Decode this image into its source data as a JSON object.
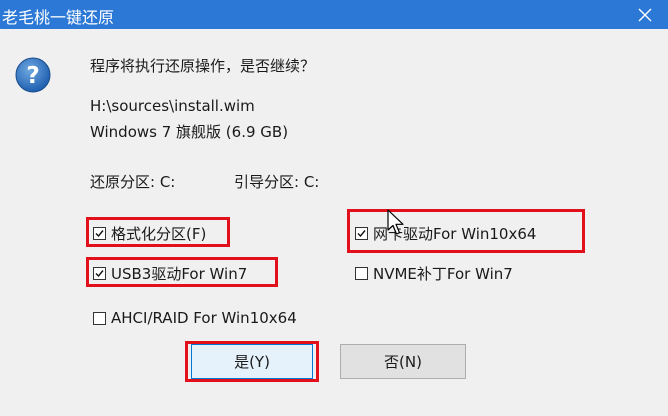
{
  "window": {
    "title": "老毛桃一键还原"
  },
  "dialog": {
    "question": "程序将执行还原操作，是否继续？",
    "image_path": "H:\\sources\\install.wim",
    "image_edition": "Windows 7 旗舰版 (6.9 GB)",
    "restore_partition": "还原分区: C:",
    "boot_partition": "引导分区: C:"
  },
  "options": {
    "format_partition": {
      "label": "格式化分区(F)",
      "checked": true
    },
    "nic_driver": {
      "label": "网卡驱动For Win10x64",
      "checked": true
    },
    "usb3_driver": {
      "label": "USB3驱动For Win7",
      "checked": true
    },
    "nvme_patch": {
      "label": "NVME补丁For Win7",
      "checked": false
    },
    "ahci_raid": {
      "label": "AHCI/RAID For Win10x64",
      "checked": false
    }
  },
  "buttons": {
    "yes": "是(Y)",
    "no": "否(N)"
  },
  "colors": {
    "titlebar": "#2b78d6",
    "highlight": "#e1101a",
    "dialog_bg": "#f0f0f0"
  },
  "icons": {
    "question": "question-icon",
    "close": "close-icon",
    "cursor": "mouse-cursor-icon"
  }
}
